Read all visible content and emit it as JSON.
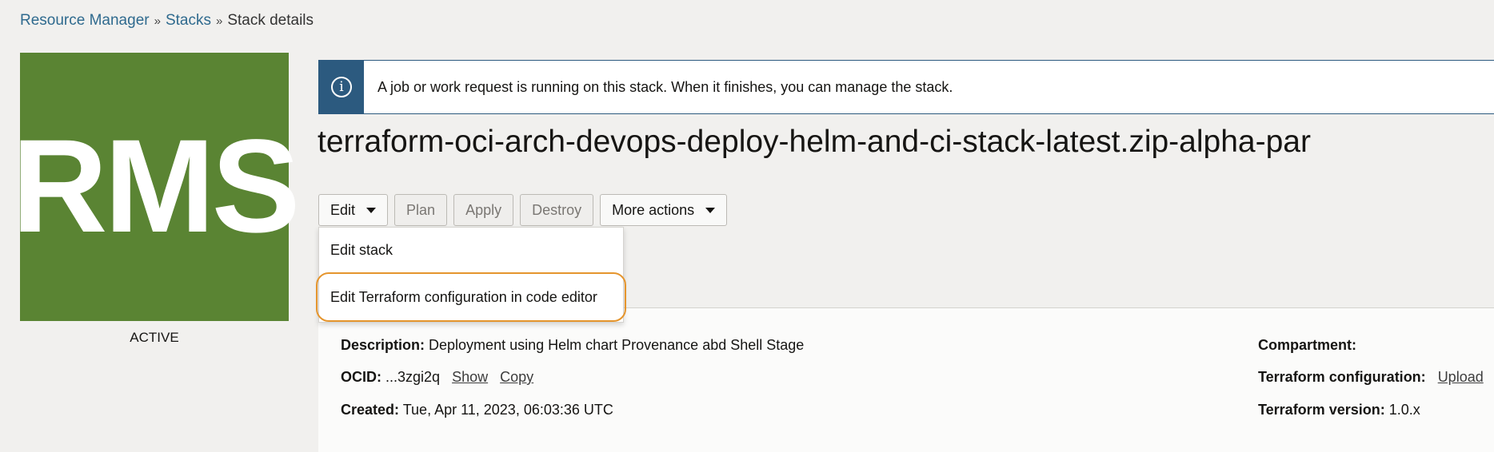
{
  "breadcrumb": {
    "items": [
      "Resource Manager",
      "Stacks"
    ],
    "current": "Stack details",
    "separator": "»"
  },
  "tile": {
    "label": "RMS",
    "color": "#5a8433",
    "status": "ACTIVE"
  },
  "banner": {
    "icon": "info-icon",
    "message": "A job or work request is running on this stack. When it finishes, you can manage the stack."
  },
  "title": "terraform-oci-arch-devops-deploy-helm-and-ci-stack-latest.zip-alpha-par",
  "toolbar": {
    "edit": "Edit",
    "plan": "Plan",
    "apply": "Apply",
    "destroy": "Destroy",
    "more": "More actions"
  },
  "edit_menu": {
    "items": [
      "Edit stack",
      "Edit Terraform configuration in code editor"
    ]
  },
  "details": {
    "description_label": "Description:",
    "description_value": "Deployment using Helm chart Provenance abd Shell Stage",
    "ocid_label": "OCID:",
    "ocid_value": "...3zgi2q",
    "show": "Show",
    "copy": "Copy",
    "created_label": "Created:",
    "created_value": "Tue, Apr 11, 2023, 06:03:36 UTC",
    "compartment_label": "Compartment:",
    "tfconfig_label": "Terraform configuration:",
    "tfconfig_value": "Upload",
    "tfversion_label": "Terraform version:",
    "tfversion_value": "1.0.x"
  }
}
